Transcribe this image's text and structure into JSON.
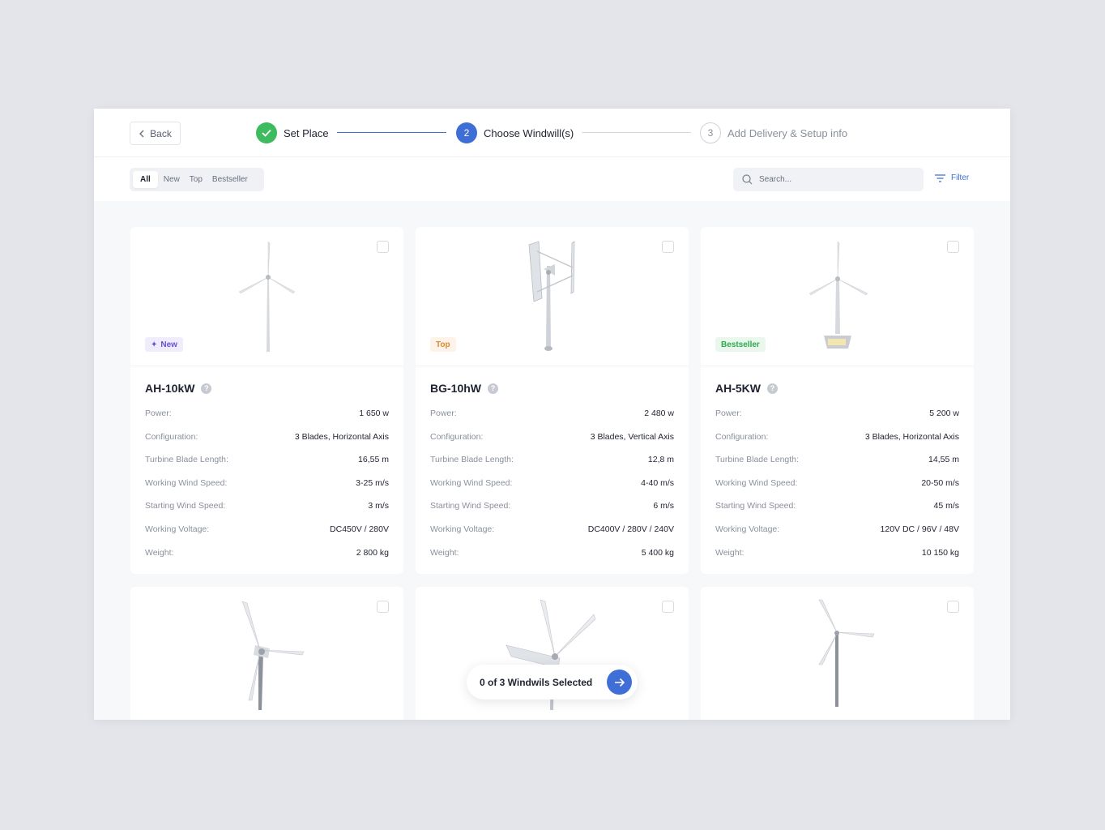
{
  "header": {
    "back_label": "Back",
    "steps": [
      {
        "number": "1",
        "label": "Set Place",
        "state": "done"
      },
      {
        "number": "2",
        "label": "Choose Windwill(s)",
        "state": "active"
      },
      {
        "number": "3",
        "label": "Add Delivery & Setup info",
        "state": "pending"
      }
    ]
  },
  "toolbar": {
    "tabs": [
      "All",
      "New",
      "Top",
      "Bestseller"
    ],
    "active_tab": "All",
    "search_placeholder": "Search...",
    "filter_label": "Filter"
  },
  "spec_labels": {
    "power": "Power:",
    "configuration": "Configuration:",
    "blade_length": "Turbine Blade Length:",
    "working_speed": "Working Wind Speed:",
    "starting_speed": "Starting Wind Speed:",
    "voltage": "Working Voltage:",
    "weight": "Weight:"
  },
  "products": [
    {
      "name": "AH-10kW",
      "badge": "New",
      "power": "1 650 w",
      "configuration": "3 Blades, Horizontal Axis",
      "blade_length": "16,55 m",
      "working_speed": "3-25 m/s",
      "starting_speed": "3 m/s",
      "voltage": "DC450V / 280V",
      "weight": "2 800 kg"
    },
    {
      "name": "BG-10hW",
      "badge": "Top",
      "power": "2 480 w",
      "configuration": "3 Blades, Vertical Axis",
      "blade_length": "12,8 m",
      "working_speed": "4-40 m/s",
      "starting_speed": "6 m/s",
      "voltage": "DC400V / 280V / 240V",
      "weight": "5 400 kg"
    },
    {
      "name": "AH-5KW",
      "badge": "Bestseller",
      "power": "5 200 w",
      "configuration": "3 Blades, Horizontal Axis",
      "blade_length": "14,55 m",
      "working_speed": "20-50 m/s",
      "starting_speed": "45 m/s",
      "voltage": "120V DC / 96V / 48V",
      "weight": "10 150 kg"
    }
  ],
  "selection": {
    "text": "0 of 3 Windwils Selected"
  },
  "colors": {
    "accent": "#3f6fd6",
    "done": "#3dbb5e",
    "badge_new": "#6c4fd1",
    "badge_top": "#d98a34",
    "badge_bestseller": "#2fa84f"
  }
}
